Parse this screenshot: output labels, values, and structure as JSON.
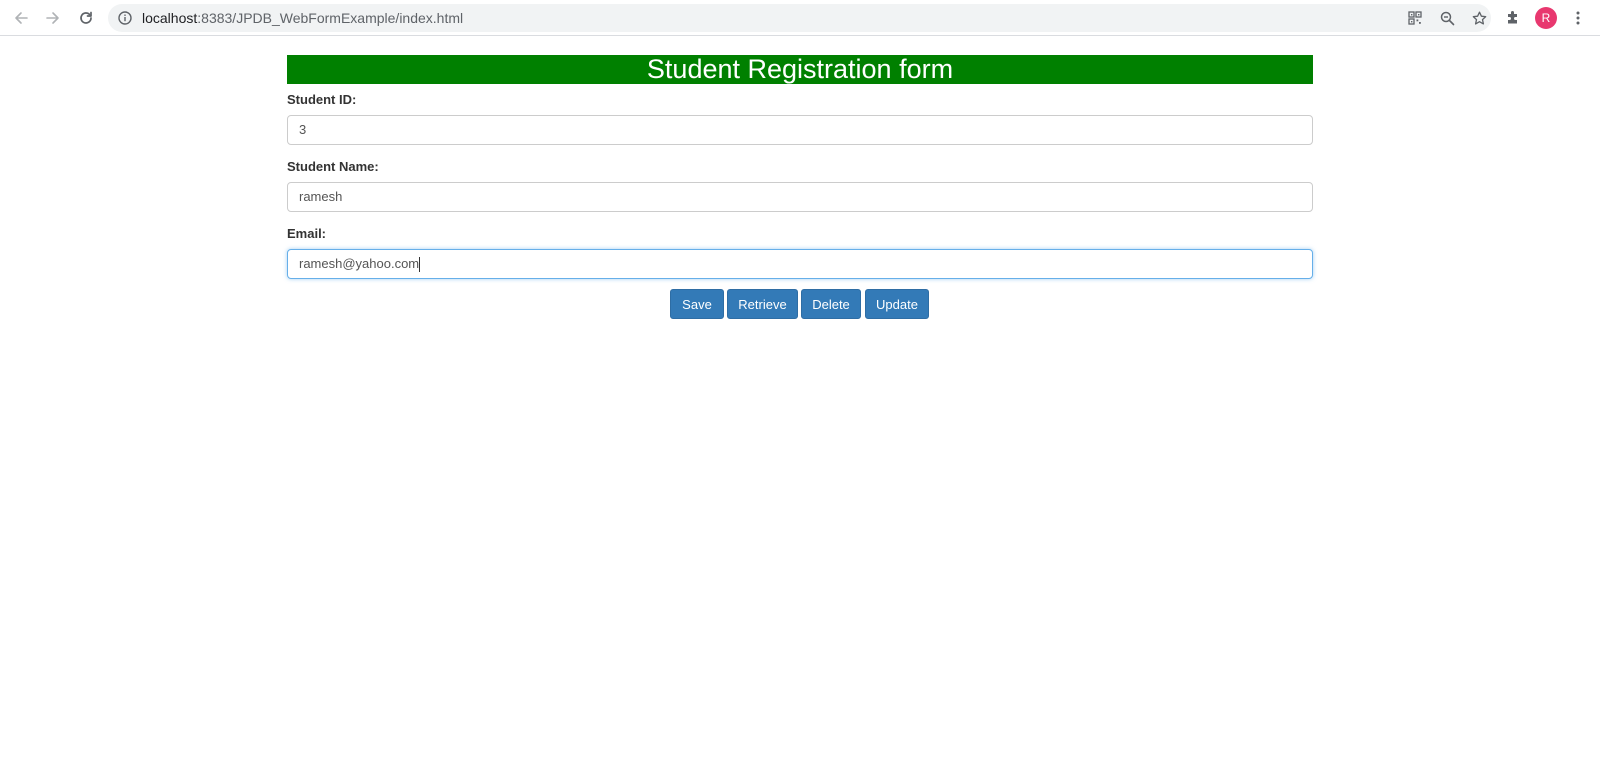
{
  "browser": {
    "url_host": "localhost",
    "url_path": ":8383/JPDB_WebFormExample/index.html",
    "icons": {
      "back": "arrow-left-icon",
      "forward": "arrow-right-icon",
      "reload": "reload-icon",
      "site_info": "info-icon",
      "qr": "qr-code-icon",
      "zoom": "zoom-out-icon",
      "bookmark": "star-icon",
      "extensions": "puzzle-icon",
      "menu": "more-vert-icon"
    },
    "profile_initial": "R",
    "profile_color": "#e8386f"
  },
  "form": {
    "title": "Student Registration form",
    "title_bg": "#008000",
    "fields": [
      {
        "label": "Student ID:",
        "value": "3"
      },
      {
        "label": "Student Name:",
        "value": "ramesh"
      },
      {
        "label": "Email:",
        "value": "ramesh@yahoo.com"
      }
    ],
    "buttons": {
      "save": "Save",
      "retrieve": "Retrieve",
      "delete": "Delete",
      "update": "Update"
    },
    "button_color": "#337ab7"
  }
}
